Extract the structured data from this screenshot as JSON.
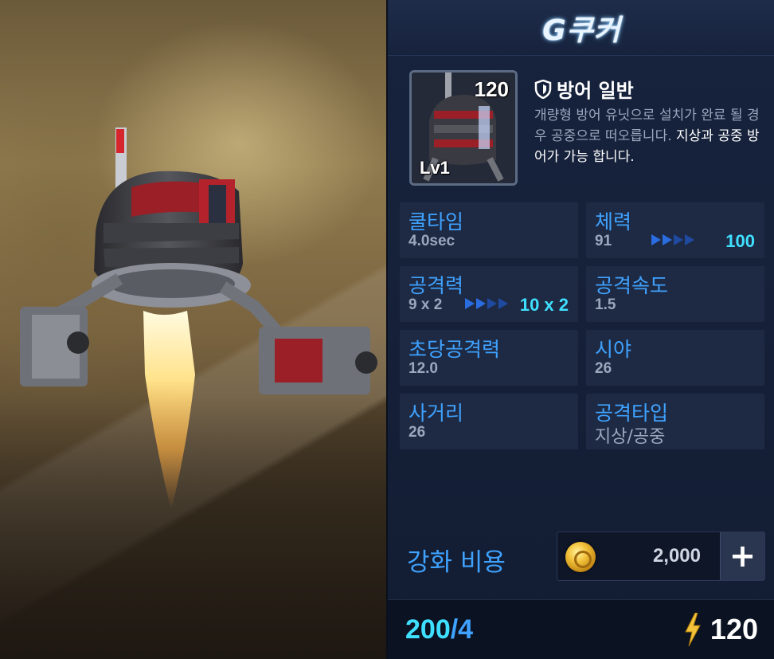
{
  "unit": {
    "name": "G쿠커",
    "level_number": "120",
    "level_label": "Lv1",
    "type": "방어 일반",
    "description_plain": "개량형 방어 유닛으로 설치가 완료 될 경우 공중으로 떠오릅니다.",
    "description_highlight": " 지상과 공중 방어가 가능 합니다."
  },
  "stats": [
    {
      "name": "쿨타임",
      "value": "4.0sec"
    },
    {
      "name": "체력",
      "value": "91",
      "upgrade": "100"
    },
    {
      "name": "공격력",
      "value": "9 x 2",
      "upgrade": "10 x 2"
    },
    {
      "name": "공격속도",
      "value": "1.5"
    },
    {
      "name": "초당공격력",
      "value": "12.0"
    },
    {
      "name": "시야",
      "value": "26"
    },
    {
      "name": "사거리",
      "value": "26"
    },
    {
      "name": "공격타입",
      "value": "지상/공중"
    }
  ],
  "upgrade": {
    "label": "강화 비용",
    "cost": "2,000",
    "plus": "+"
  },
  "footer": {
    "count": "200",
    "count_slash": "/4",
    "energy": "120"
  },
  "colors": {
    "accent_blue": "#3fa2ff",
    "accent_cyan": "#3fe0ff",
    "panel_bg": "#17233d",
    "cell_bg": "#1e2a44"
  },
  "icons": [
    "shield-icon",
    "coin-icon",
    "lightning-icon",
    "plus-icon",
    "arrow-icon"
  ]
}
